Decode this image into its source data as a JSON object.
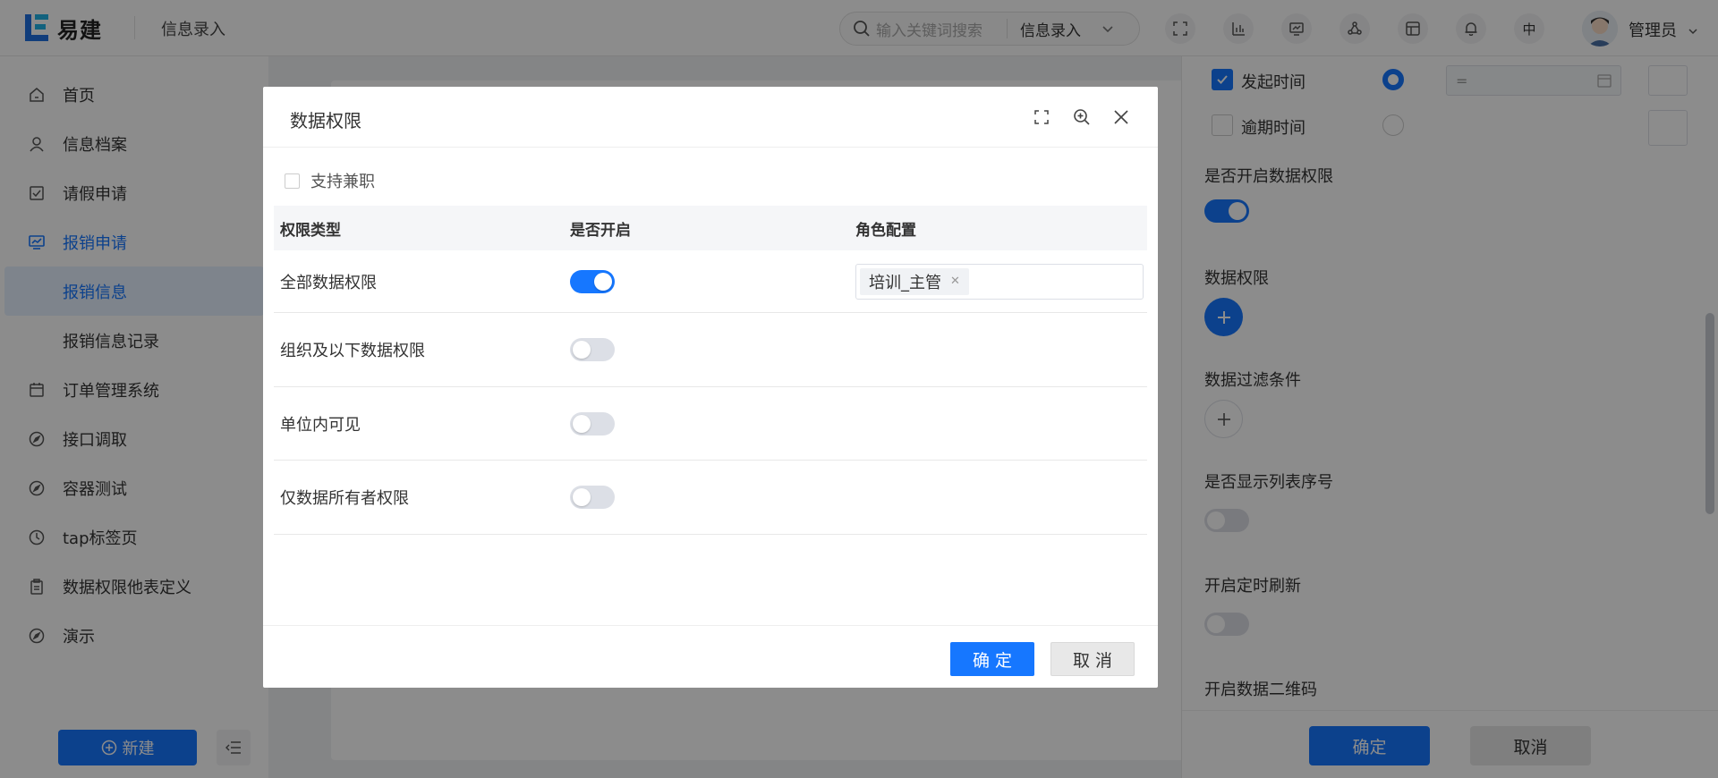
{
  "header": {
    "logo_text": "易建",
    "page_title": "信息录入",
    "search_placeholder": "输入关键词搜索",
    "search_scope": "信息录入",
    "language": "中",
    "user_name": "管理员"
  },
  "sidebar": {
    "items": [
      {
        "label": "首页",
        "icon": "home-icon"
      },
      {
        "label": "信息档案",
        "icon": "user-icon"
      },
      {
        "label": "请假申请",
        "icon": "checklist-icon"
      },
      {
        "label": "报销申请",
        "icon": "monitor-icon"
      },
      {
        "label": "报销信息",
        "icon": ""
      },
      {
        "label": "报销信息记录",
        "icon": ""
      },
      {
        "label": "订单管理系统",
        "icon": "calendar-icon"
      },
      {
        "label": "接口调取",
        "icon": "compass-icon"
      },
      {
        "label": "容器测试",
        "icon": "compass-icon"
      },
      {
        "label": "tap标签页",
        "icon": "clock-icon"
      },
      {
        "label": "数据权限他表定义",
        "icon": "clipboard-icon"
      },
      {
        "label": "演示",
        "icon": "compass-icon"
      }
    ],
    "new_button": "新建"
  },
  "right_panel": {
    "start_time_label": "发起时间",
    "overdue_label": "逾期时间",
    "equals_value": "=",
    "enable_data_permission_label": "是否开启数据权限",
    "data_permission_label": "数据权限",
    "data_filter_label": "数据过滤条件",
    "show_list_number_label": "是否显示列表序号",
    "timed_refresh_label": "开启定时刷新",
    "qr_code_label": "开启数据二维码",
    "confirm_button": "确定",
    "cancel_button": "取消"
  },
  "modal": {
    "title": "数据权限",
    "support_part_time_label": "支持兼职",
    "columns": [
      "权限类型",
      "是否开启",
      "角色配置"
    ],
    "rows": [
      {
        "type": "全部数据权限",
        "enabled": true,
        "roles": [
          "培训_主管"
        ]
      },
      {
        "type": "组织及以下数据权限",
        "enabled": false,
        "roles": []
      },
      {
        "type": "单位内可见",
        "enabled": false,
        "roles": []
      },
      {
        "type": "仅数据所有者权限",
        "enabled": false,
        "roles": []
      }
    ],
    "confirm_button": "确 定",
    "cancel_button": "取 消"
  },
  "colors": {
    "primary": "#1677ff",
    "overlay": "rgba(0,0,0,0.45)"
  }
}
